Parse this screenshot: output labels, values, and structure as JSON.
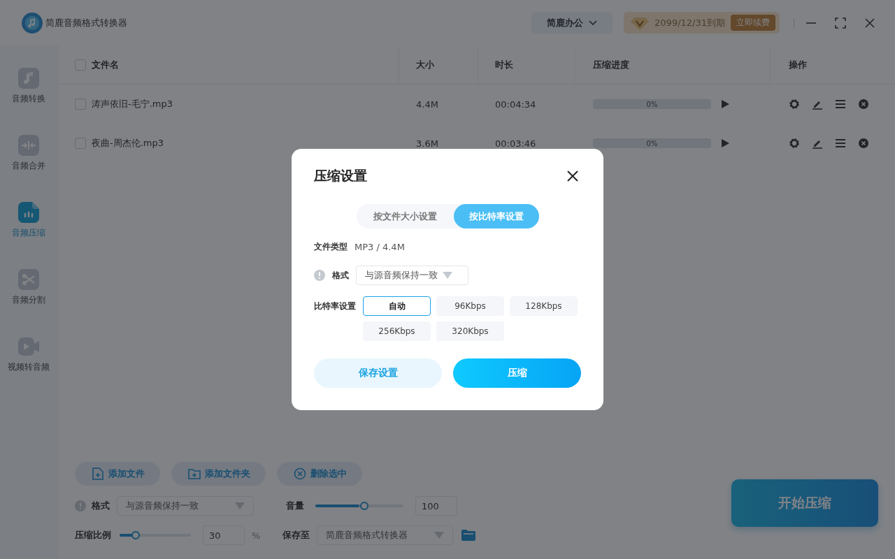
{
  "app": {
    "title": "简鹿音频格式转换器",
    "account": "简鹿办公",
    "vip": {
      "expiry": "2099/12/31到期",
      "renew": "立即续费"
    }
  },
  "sidebar": {
    "items": [
      {
        "label": "音频转换",
        "selected": false
      },
      {
        "label": "音频合并",
        "selected": false
      },
      {
        "label": "音频压缩",
        "selected": true
      },
      {
        "label": "音频分割",
        "selected": false
      },
      {
        "label": "视频转音频",
        "selected": false
      }
    ]
  },
  "table": {
    "header_checked": false,
    "columns": [
      "文件名",
      "大小",
      "时长",
      "压缩进度",
      "操作"
    ],
    "rows": [
      {
        "checked": false,
        "name": "涛声依旧-毛宁.mp3",
        "size": "4.4M",
        "duration": "00:04:34",
        "progress": "0%",
        "level": 0
      },
      {
        "checked": false,
        "name": "夜曲-周杰伦.mp3",
        "size": "3.6M",
        "duration": "00:03:46",
        "progress": "0%",
        "level": 0
      }
    ]
  },
  "toolbar": [
    {
      "label": "添加文件"
    },
    {
      "label": "添加文件夹"
    },
    {
      "label": "删除选中"
    }
  ],
  "settings": {
    "format_label": "格式",
    "format_value": "与源音频保持一致",
    "volume_label": "音量",
    "volume": {
      "level": 0.5
    },
    "volume_value": "100",
    "ratio_label": "压缩比例",
    "ratio": {
      "level": 0.2
    },
    "ratio_value": "30",
    "ratio_unit": "%",
    "save_label": "保存至",
    "save_value": "简鹿音频格式转换器"
  },
  "start_button": "开始压缩",
  "dialog": {
    "title": "压缩设置",
    "tabs": [
      {
        "label": "按文件大小设置",
        "selected": false
      },
      {
        "label": "按比特率设置",
        "selected": true
      }
    ],
    "file_type_label": "文件类型",
    "file_type_value": "MP3 / 4.4M",
    "format_label": "格式",
    "format_value": "与源音频保持一致",
    "bitrate_label": "比特率设置",
    "bitrates": [
      {
        "label": "自动",
        "selected": true
      },
      {
        "label": "96Kbps",
        "selected": false
      },
      {
        "label": "128Kbps",
        "selected": false
      },
      {
        "label": "256Kbps",
        "selected": false
      },
      {
        "label": "320Kbps",
        "selected": false
      }
    ],
    "buttons": [
      {
        "label": "保存设置",
        "kind": "secondary"
      },
      {
        "label": "压缩",
        "kind": "primary"
      }
    ]
  }
}
